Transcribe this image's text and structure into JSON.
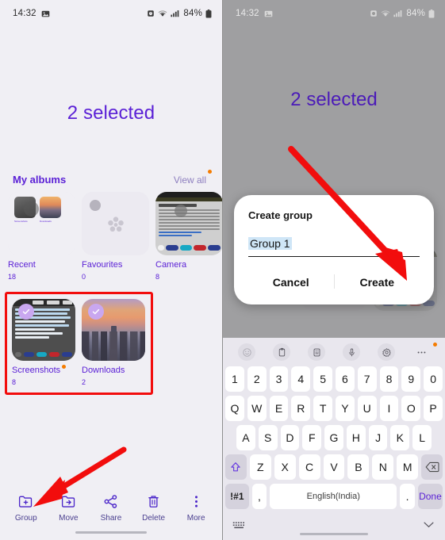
{
  "left_phone": {
    "status_bar": {
      "time": "14:32",
      "left_icons": [
        "image-icon"
      ],
      "right_icons": [
        "alarm-icon",
        "wifi-icon",
        "signal-icon"
      ],
      "battery": "84%"
    },
    "selection_title": "2 selected",
    "albums_section": {
      "title": "My albums",
      "view_all": "View all",
      "view_all_badge": true,
      "albums": [
        {
          "name": "Recent",
          "count": "18",
          "thumb": "recent-collage",
          "selected": false
        },
        {
          "name": "Favourites",
          "count": "0",
          "thumb": "empty-flower",
          "selected": false
        },
        {
          "name": "Camera",
          "count": "8",
          "thumb": "article-screenshot",
          "selected": false
        }
      ],
      "selected_albums": [
        {
          "name": "Screenshots",
          "count": "8",
          "thumb": "screenshot-art",
          "selected": true,
          "badge": true
        },
        {
          "name": "Downloads",
          "count": "2",
          "thumb": "city-sunset",
          "selected": true,
          "badge": false
        }
      ]
    },
    "toolbar": [
      {
        "label": "Group",
        "icon": "folder-plus-icon"
      },
      {
        "label": "Move",
        "icon": "folder-arrow-icon"
      },
      {
        "label": "Share",
        "icon": "share-icon"
      },
      {
        "label": "Delete",
        "icon": "trash-icon"
      },
      {
        "label": "More",
        "icon": "more-vertical-icon"
      }
    ]
  },
  "right_phone": {
    "status_bar": {
      "time": "14:32",
      "battery": "84%"
    },
    "selection_title": "2 selected",
    "dialog": {
      "title": "Create group",
      "input_value": "Group 1",
      "cancel_label": "Cancel",
      "create_label": "Create"
    },
    "keyboard": {
      "toolbar_icons": [
        "emoji-icon",
        "clipboard-icon",
        "text-extract-icon",
        "mic-icon",
        "gear-icon",
        "more-horizontal-icon"
      ],
      "toolbar_badge": true,
      "row_numbers": [
        "1",
        "2",
        "3",
        "4",
        "5",
        "6",
        "7",
        "8",
        "9",
        "0"
      ],
      "row_1": [
        "Q",
        "W",
        "E",
        "R",
        "T",
        "Y",
        "U",
        "I",
        "O",
        "P"
      ],
      "row_2": [
        "A",
        "S",
        "D",
        "F",
        "G",
        "H",
        "J",
        "K",
        "L"
      ],
      "row_3_keys": [
        "Z",
        "X",
        "C",
        "V",
        "B",
        "N",
        "M"
      ],
      "shift_icon": "shift-up-icon",
      "backspace_icon": "backspace-icon",
      "symbols_label": "!#1",
      "comma_label": ",",
      "space_label": "English(India)",
      "period_label": ".",
      "done_label": "Done",
      "keyboard_toggle_icon": "keyboard-icon",
      "collapse_icon": "chevron-down-icon"
    }
  },
  "annotations": {
    "color": "#f20d0d",
    "arrows": [
      {
        "name": "arrow-to-group-button"
      },
      {
        "name": "arrow-to-create-button"
      }
    ],
    "highlight_box": {
      "name": "selected-albums-highlight",
      "color": "#f20d0d"
    }
  },
  "theme": {
    "accent_purple": "#5b21d6",
    "bg": "#f0eff4",
    "check_circle": "#c9a7f0",
    "badge_orange": "#f57c00"
  }
}
